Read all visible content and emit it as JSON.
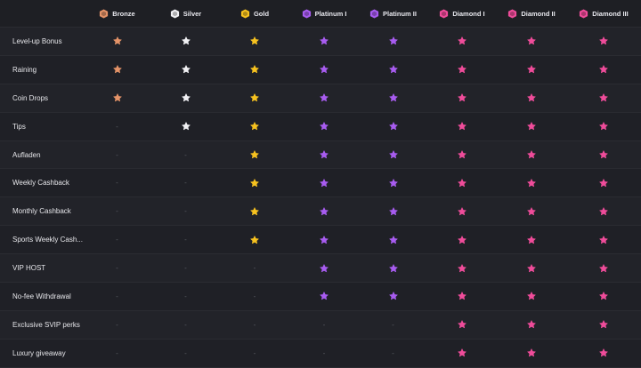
{
  "colors": {
    "bronze": "#e49368",
    "silver": "#f1f1f4",
    "gold": "#f7c21f",
    "platinum": "#a85cf0",
    "diamond": "#ef4c9a",
    "dash": "#5a5b63"
  },
  "tiers": [
    {
      "key": "bronze",
      "label": "Bronze",
      "icon": "bronze-badge-icon"
    },
    {
      "key": "silver",
      "label": "Silver",
      "icon": "silver-badge-icon"
    },
    {
      "key": "gold",
      "label": "Gold",
      "icon": "gold-badge-icon"
    },
    {
      "key": "platinum",
      "label": "Platinum I",
      "icon": "platinum-badge-icon"
    },
    {
      "key": "platinum",
      "label": "Platinum II",
      "icon": "platinum-badge-icon"
    },
    {
      "key": "diamond",
      "label": "Diamond I",
      "icon": "diamond-badge-icon"
    },
    {
      "key": "diamond",
      "label": "Diamond II",
      "icon": "diamond-badge-icon"
    },
    {
      "key": "diamond",
      "label": "Diamond III",
      "icon": "diamond-badge-icon"
    }
  ],
  "dash_text": "-",
  "rows": [
    {
      "label": "Level-up Bonus",
      "avail": [
        1,
        1,
        1,
        1,
        1,
        1,
        1,
        1
      ]
    },
    {
      "label": "Raining",
      "avail": [
        1,
        1,
        1,
        1,
        1,
        1,
        1,
        1
      ]
    },
    {
      "label": "Coin Drops",
      "avail": [
        1,
        1,
        1,
        1,
        1,
        1,
        1,
        1
      ]
    },
    {
      "label": "Tips",
      "avail": [
        0,
        1,
        1,
        1,
        1,
        1,
        1,
        1
      ]
    },
    {
      "label": "Aufladen",
      "avail": [
        0,
        0,
        1,
        1,
        1,
        1,
        1,
        1
      ]
    },
    {
      "label": "Weekly Cashback",
      "avail": [
        0,
        0,
        1,
        1,
        1,
        1,
        1,
        1
      ]
    },
    {
      "label": "Monthly Cashback",
      "avail": [
        0,
        0,
        1,
        1,
        1,
        1,
        1,
        1
      ]
    },
    {
      "label": "Sports Weekly Cash...",
      "avail": [
        0,
        0,
        1,
        1,
        1,
        1,
        1,
        1
      ]
    },
    {
      "label": "VIP HOST",
      "avail": [
        0,
        0,
        0,
        1,
        1,
        1,
        1,
        1
      ]
    },
    {
      "label": "No-fee Withdrawal",
      "avail": [
        0,
        0,
        0,
        1,
        1,
        1,
        1,
        1
      ]
    },
    {
      "label": "Exclusive SVIP perks",
      "avail": [
        0,
        0,
        0,
        0,
        0,
        1,
        1,
        1
      ]
    },
    {
      "label": "Luxury giveaway",
      "avail": [
        0,
        0,
        0,
        0,
        0,
        1,
        1,
        1
      ]
    }
  ]
}
